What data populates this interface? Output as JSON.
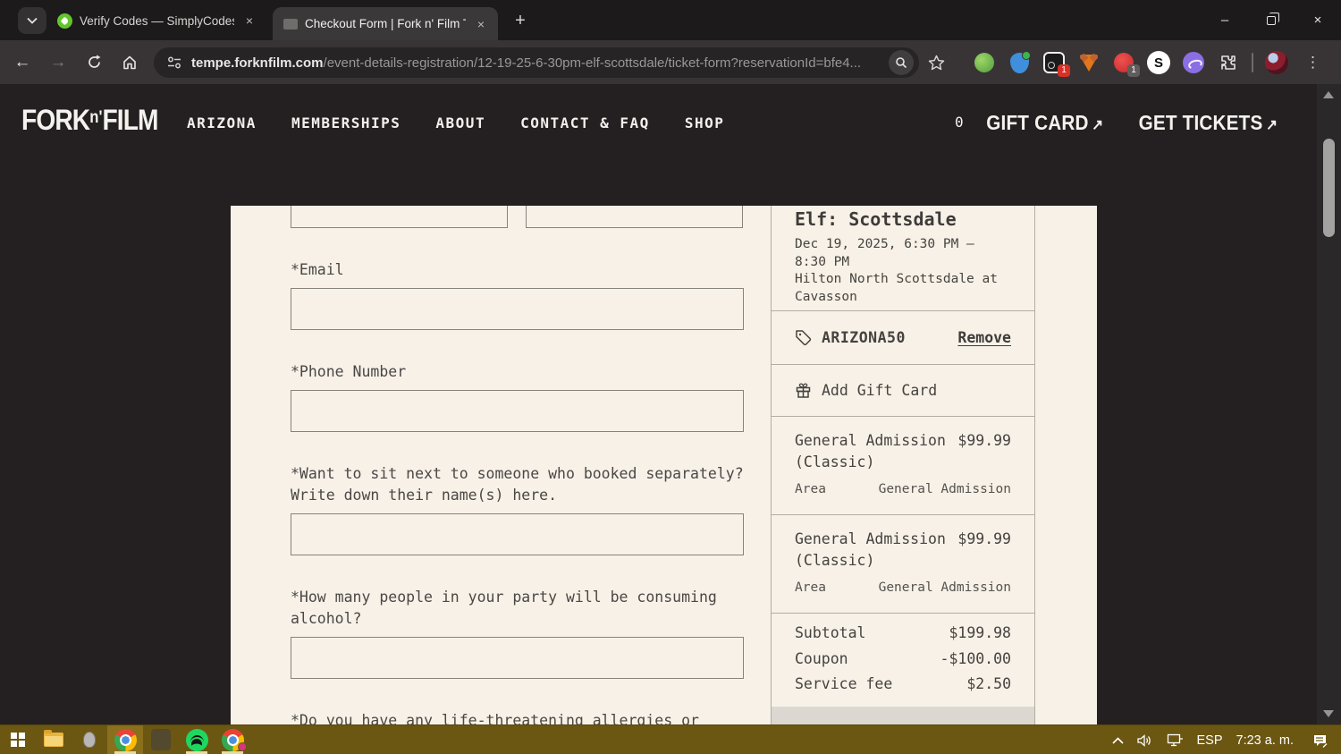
{
  "browser": {
    "tabs": [
      {
        "title": "Verify Codes — SimplyCodes"
      },
      {
        "title": "Checkout Form | Fork n' Film Te"
      }
    ],
    "url": {
      "domain": "tempe.forknfilm.com",
      "path": "/event-details-registration/12-19-25-6-30pm-elf-scottsdale/ticket-form?reservationId=bfe4..."
    },
    "extensions": {
      "wallet_badge": "1",
      "blocker_badge": "1",
      "simplycodes_letter": "S"
    }
  },
  "icons": {
    "back": "←",
    "forward": "→",
    "plus": "+",
    "close": "×",
    "kebab": "⋮",
    "minimize": "–",
    "cta_arrow": "↗"
  },
  "site_header": {
    "logo_main": "FORK",
    "logo_apos": "n'",
    "logo_rest": "FILM",
    "nav": [
      {
        "label": "ARIZONA"
      },
      {
        "label": "MEMBERSHIPS"
      },
      {
        "label": "ABOUT"
      },
      {
        "label": "CONTACT & FAQ"
      },
      {
        "label": "SHOP"
      }
    ],
    "cart_count": "0",
    "gift_card_label": "GIFT CARD",
    "get_tickets_label": "GET TICKETS"
  },
  "form": {
    "fields": [
      {
        "label": "*Email"
      },
      {
        "label": "*Phone Number"
      },
      {
        "label": "*Want to sit next to someone who booked separately? Write down their name(s) here."
      },
      {
        "label": "*How many people in your party will be consuming alcohol?"
      }
    ],
    "next_field_label": "*Do you have any life-threatening allergies or"
  },
  "order_summary": {
    "event_title": "Elf: Scottsdale",
    "event_datetime": "Dec 19, 2025, 6:30 PM – 8:30 PM",
    "event_venue": "Hilton North Scottsdale at Cavasson",
    "coupon_code": "ARIZONA50",
    "remove_label": "Remove",
    "add_gift_card_label": "Add Gift Card",
    "items": [
      {
        "name": "General Admission (Classic)",
        "price": "$99.99",
        "area_label": "Area",
        "area_value": "General Admission"
      },
      {
        "name": "General Admission (Classic)",
        "price": "$99.99",
        "area_label": "Area",
        "area_value": "General Admission"
      }
    ],
    "totals": [
      {
        "label": "Subtotal",
        "value": "$199.98"
      },
      {
        "label": "Coupon",
        "value": "-$100.00"
      },
      {
        "label": "Service fee",
        "value": "$2.50"
      }
    ]
  },
  "taskbar": {
    "language": "ESP",
    "time": "7:23 a. m."
  },
  "colors": {
    "page_dark": "#242021",
    "content_cream": "#f7f1e8",
    "taskbar_gold": "#6b5712",
    "coupon_badge_red": "#d93025"
  }
}
